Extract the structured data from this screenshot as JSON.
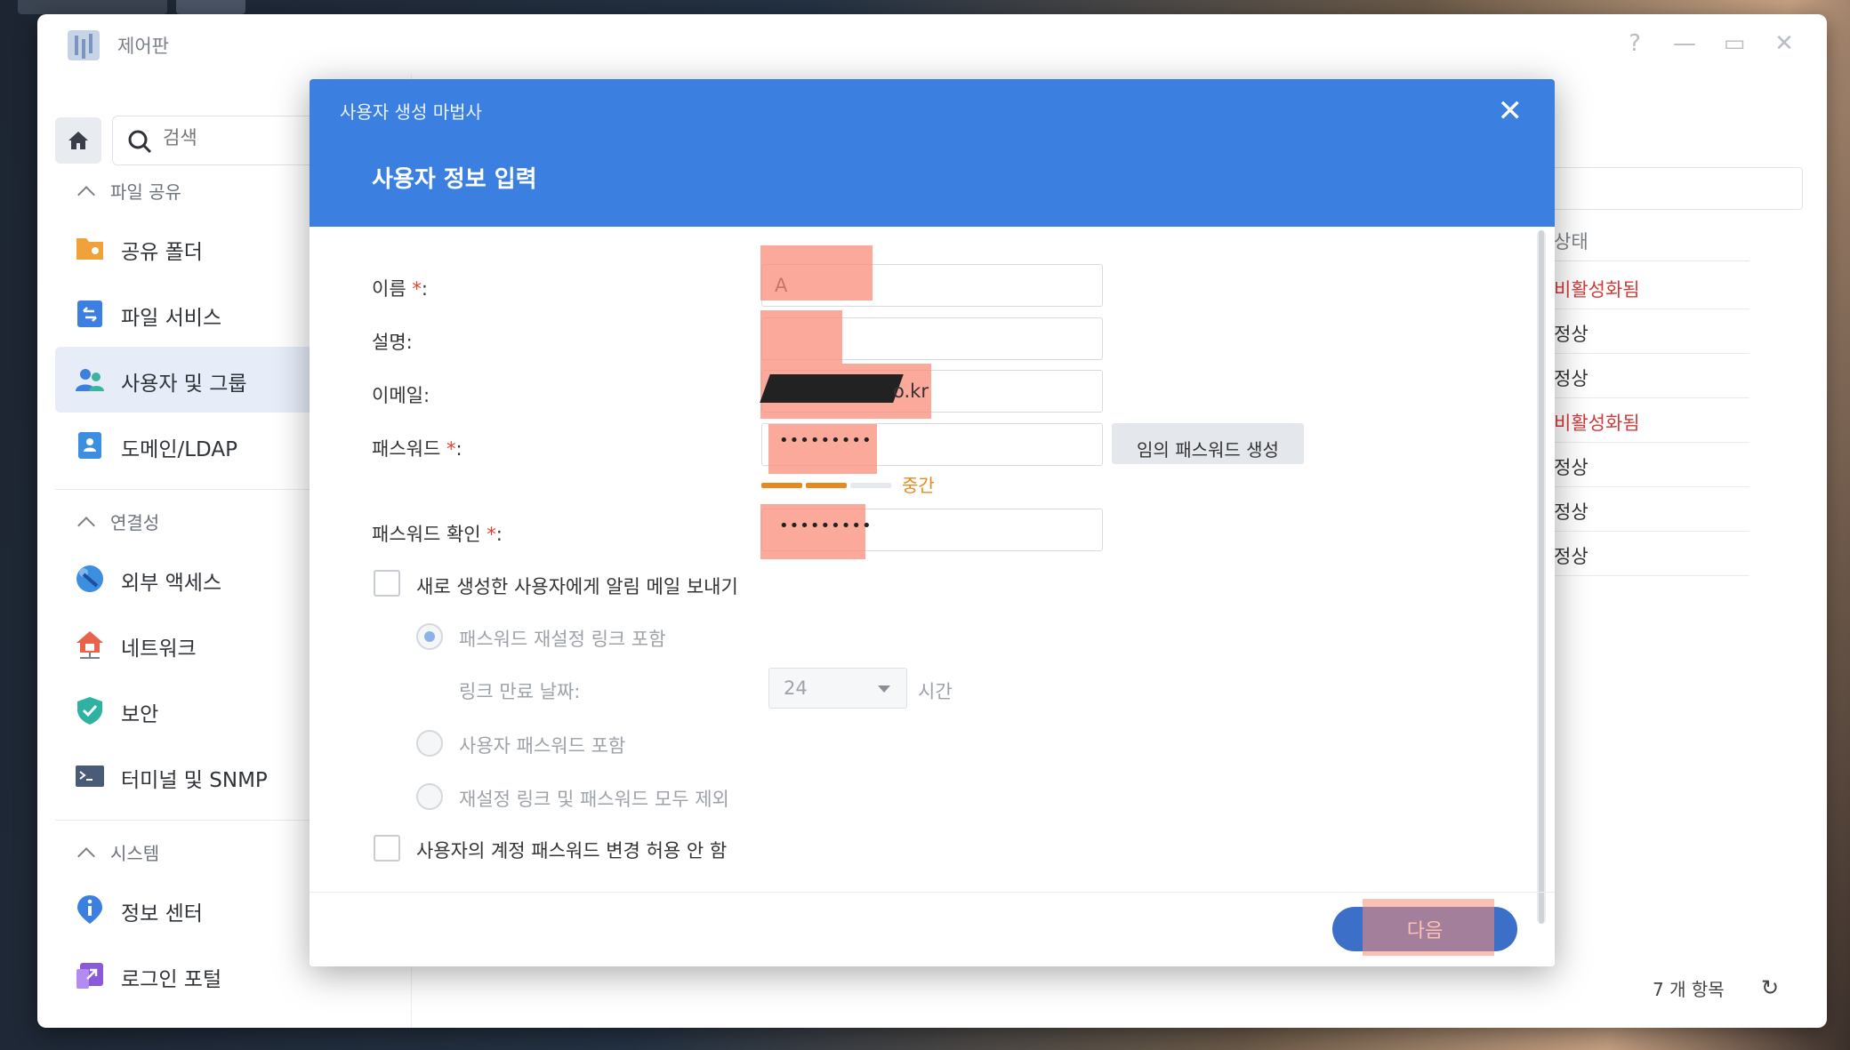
{
  "app": {
    "title": "제어판",
    "help": "?",
    "minimize": "—",
    "maximize": "▭",
    "close": "✕"
  },
  "sidebar": {
    "search_placeholder": "검색",
    "sections": [
      {
        "label": "파일 공유"
      },
      {
        "label": "연결성"
      },
      {
        "label": "시스템"
      }
    ],
    "items": [
      {
        "label": "공유 폴더",
        "icon": "shared-folder-icon",
        "color": "#f0a23a"
      },
      {
        "label": "파일 서비스",
        "icon": "file-services-icon",
        "color": "#3b7fe0"
      },
      {
        "label": "사용자 및 그룹",
        "icon": "users-groups-icon",
        "color": "#3bb3a0"
      },
      {
        "label": "도메인/LDAP",
        "icon": "domain-ldap-icon",
        "color": "#3b8ee0"
      },
      {
        "label": "외부 액세스",
        "icon": "external-access-icon",
        "color": "#3b8ee0"
      },
      {
        "label": "네트워크",
        "icon": "network-icon",
        "color": "#e8634a"
      },
      {
        "label": "보안",
        "icon": "security-shield-icon",
        "color": "#2eb3a2"
      },
      {
        "label": "터미널 및 SNMP",
        "icon": "terminal-icon",
        "color": "#4a5b78"
      },
      {
        "label": "정보 센터",
        "icon": "info-center-icon",
        "color": "#3b7fe0"
      },
      {
        "label": "로그인 포털",
        "icon": "login-portal-icon",
        "color": "#8a5ad8"
      }
    ]
  },
  "main": {
    "status_header": "상태",
    "status_rows": [
      "비활성화됨",
      "정상",
      "정상",
      "비활성화됨",
      "정상",
      "정상",
      "정상"
    ],
    "item_count": "7 개 항목",
    "refresh": "↻"
  },
  "dialog": {
    "wizard_title": "사용자 생성 마법사",
    "heading": "사용자 정보 입력",
    "close": "✕",
    "fields": {
      "name_label": "이름",
      "name_value": "A",
      "description_label": "설명:",
      "description_value": "",
      "email_label": "이메일:",
      "email_value": "o.kr",
      "password_label": "패스워드",
      "password_value": "•••••••••",
      "confirm_label": "패스워드 확인",
      "confirm_value": "•••••••••",
      "required_mark": "*",
      "colon": ":"
    },
    "generate_button": "임의 패스워드 생성",
    "strength_text": "중간",
    "strength_level": 0.5,
    "notify_checkbox_label": "새로 생성한 사용자에게 알림 메일 보내기",
    "radio_options": [
      "패스워드 재설정 링크 포함",
      "사용자 패스워드 포함",
      "재설정 링크 및 패스워드 모두 제외"
    ],
    "link_expiry_label": "링크 만료 날짜:",
    "link_expiry_value": "24",
    "link_expiry_unit": "시간",
    "disallow_change_label": "사용자의 계정 패스워드 변경 허용 안 함",
    "next_button": "다음"
  }
}
